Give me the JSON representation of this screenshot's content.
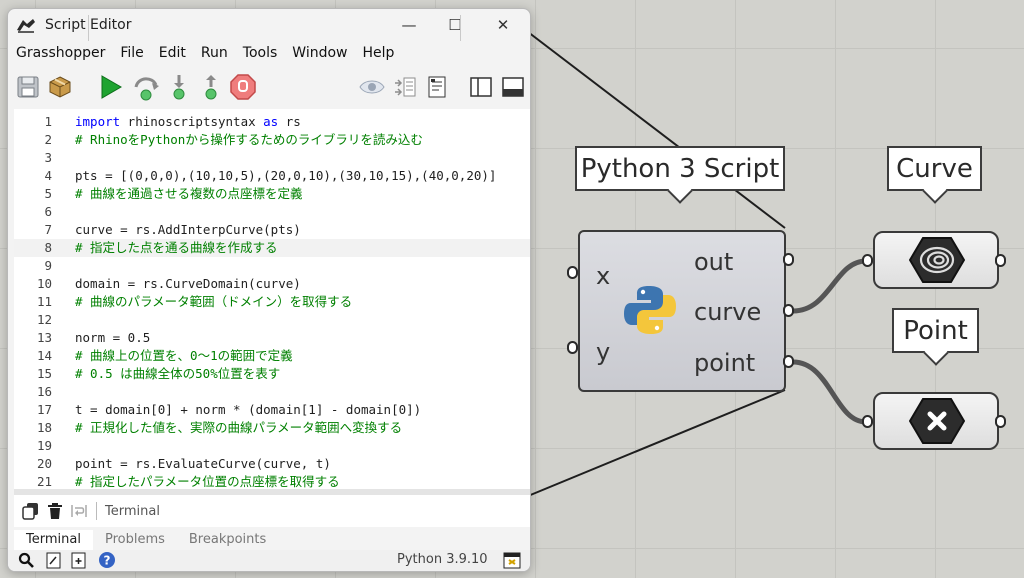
{
  "editor": {
    "title": "Script Editor",
    "minimize_glyph": "—",
    "maximize_glyph": "☐",
    "close_glyph": "✕",
    "menu": [
      "Grasshopper",
      "File",
      "Edit",
      "Run",
      "Tools",
      "Window",
      "Help"
    ],
    "toolbar_icons": [
      "save-icon",
      "package-icon",
      "run-icon",
      "step-over-icon",
      "step-into-icon",
      "step-out-icon",
      "stop-icon",
      "preview-eye-icon",
      "compare-icon",
      "document-icon",
      "panel-left-icon",
      "panel-bottom-icon"
    ],
    "code_lines": [
      {
        "n": "1",
        "kw": "import",
        "rest": " rhinoscriptsyntax ",
        "kw2": "as",
        "rest2": " rs"
      },
      {
        "n": "2",
        "comment": "# RhinoをPythonから操作するためのライブラリを読み込む"
      },
      {
        "n": "3",
        "plain": ""
      },
      {
        "n": "4",
        "plain": "pts = [(0,0,0),(10,10,5),(20,0,10),(30,10,15),(40,0,20)]"
      },
      {
        "n": "5",
        "comment": "# 曲線を通過させる複数の点座標を定義"
      },
      {
        "n": "6",
        "plain": ""
      },
      {
        "n": "7",
        "plain": "curve = rs.AddInterpCurve(pts)"
      },
      {
        "n": "8",
        "comment": "# 指定した点を通る曲線を作成する"
      },
      {
        "n": "9",
        "plain": ""
      },
      {
        "n": "10",
        "plain": "domain = rs.CurveDomain(curve)"
      },
      {
        "n": "11",
        "comment": "# 曲線のパラメータ範囲（ドメイン）を取得する"
      },
      {
        "n": "12",
        "plain": ""
      },
      {
        "n": "13",
        "plain": "norm = 0.5"
      },
      {
        "n": "14",
        "comment": "# 曲線上の位置を、0～1の範囲で定義"
      },
      {
        "n": "15",
        "comment": "# 0.5 は曲線全体の50%位置を表す"
      },
      {
        "n": "16",
        "plain": ""
      },
      {
        "n": "17",
        "plain": "t = domain[0] + norm * (domain[1] - domain[0])"
      },
      {
        "n": "18",
        "comment": "# 正規化した値を、実際の曲線パラメータ範囲へ変換する"
      },
      {
        "n": "19",
        "plain": ""
      },
      {
        "n": "20",
        "plain": "point = rs.EvaluateCurve(curve, t)"
      },
      {
        "n": "21",
        "comment": "# 指定したパラメータ位置の点座標を取得する"
      }
    ],
    "highlighted_line": "8",
    "terminal_label": "Terminal",
    "tabs": [
      "Terminal",
      "Problems",
      "Breakpoints"
    ],
    "active_tab": "Terminal",
    "status_version": "Python 3.9.10"
  },
  "canvas": {
    "script_component": {
      "balloon": "Python 3 Script",
      "inputs": [
        "x",
        "y"
      ],
      "outputs": [
        "out",
        "curve",
        "point"
      ],
      "icon": "python-logo-icon"
    },
    "curve_param": {
      "balloon": "Curve",
      "icon": "curve-spiral-icon"
    },
    "point_param": {
      "balloon": "Point",
      "icon": "point-x-icon"
    },
    "colors": {
      "wire": "#555555",
      "component_border": "#3a3a3a",
      "python_blue": "#3d75b0",
      "python_yellow": "#f4c63b"
    }
  }
}
